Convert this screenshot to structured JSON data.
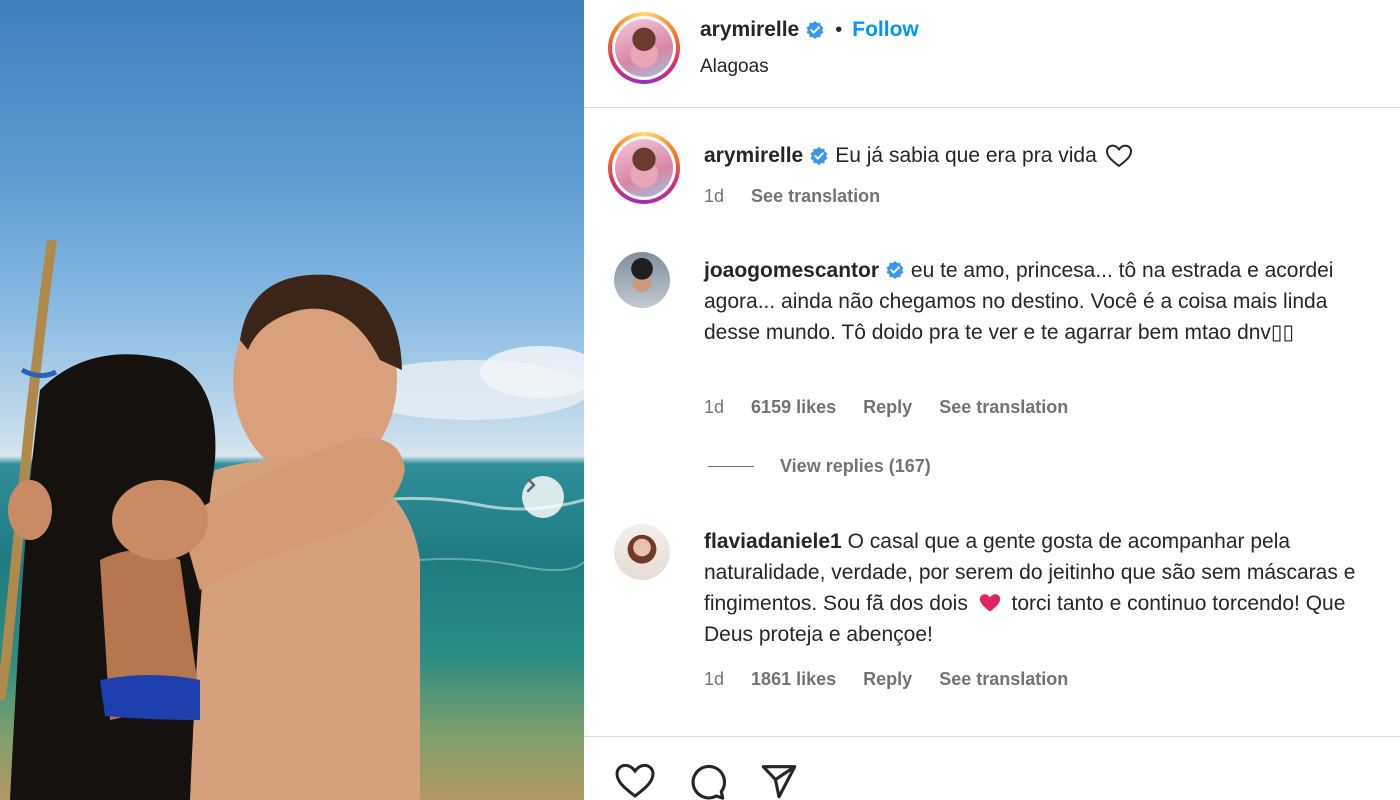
{
  "post": {
    "author": "arymirelle",
    "location": "Alagoas",
    "follow_label": "Follow",
    "separator": "•"
  },
  "caption": {
    "author": "arymirelle",
    "text": "Eu já sabia que era pra vida",
    "time": "1d",
    "translate_label": "See translation"
  },
  "comments": [
    {
      "author": "joaogomescantor",
      "verified": true,
      "text": "eu te amo, princesa... tô na estrada e acordei agora... ainda não chegamos no destino. Você é a coisa mais linda desse mundo. Tô doido pra te ver e te agarrar bem mtao dnv▯▯",
      "time": "1d",
      "likes": "6159 likes",
      "reply_label": "Reply",
      "translate_label": "See translation",
      "view_replies": "View replies (167)"
    },
    {
      "author": "flaviadaniele1",
      "verified": false,
      "text_before": "O casal que a gente gosta de acompanhar pela naturalidade, verdade, por serem do jeitinho que são sem máscaras e fingimentos. Sou fã dos dois",
      "text_after": "torci tanto e continuo torcendo! Que Deus proteja e abençoe!",
      "time": "1d",
      "likes": "1861 likes",
      "reply_label": "Reply",
      "translate_label": "See translation"
    }
  ],
  "colors": {
    "accent": "#0095f6",
    "verified": "#3897f0",
    "muted": "#737373",
    "text": "#262626",
    "heart_red": "#e0245e"
  },
  "icons": [
    "chevron-right-icon",
    "verified-badge-icon",
    "heart-outline-icon",
    "comment-icon",
    "share-icon",
    "red-heart-emoji-icon"
  ]
}
